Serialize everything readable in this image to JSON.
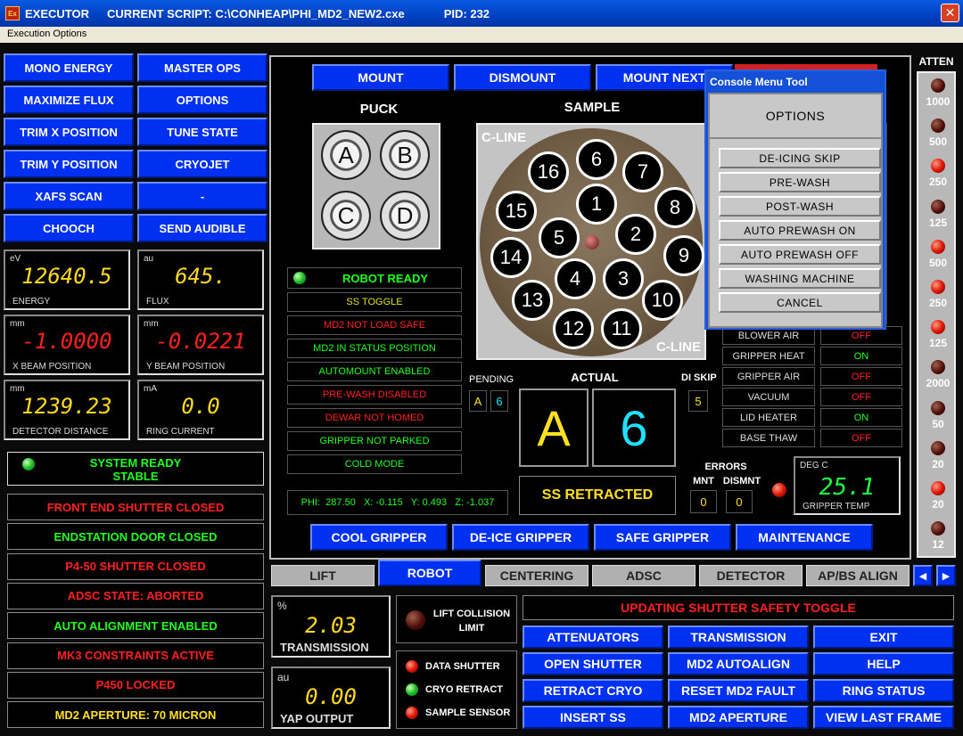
{
  "window": {
    "app": "EXECUTOR",
    "script": "CURRENT SCRIPT: C:\\CONHEAP\\PHI_MD2_NEW2.cxe",
    "pid": "PID: 232",
    "icon": "Ex",
    "close": "✕"
  },
  "menu": {
    "execution_options": "Execution Options"
  },
  "left_buttons": [
    [
      "MONO ENERGY",
      "MASTER OPS"
    ],
    [
      "MAXIMIZE FLUX",
      "OPTIONS"
    ],
    [
      "TRIM X POSITION",
      "TUNE STATE"
    ],
    [
      "TRIM Y POSITION",
      "CRYOJET"
    ],
    [
      "XAFS SCAN",
      "-"
    ],
    [
      "CHOOCH",
      "SEND AUDIBLE"
    ]
  ],
  "readouts": [
    {
      "unit": "eV",
      "value": "12640.5",
      "name": "ENERGY",
      "color": "#ffd820"
    },
    {
      "unit": "au",
      "value": "645.",
      "name": "FLUX",
      "color": "#ffd820"
    },
    {
      "unit": "mm",
      "value": "-1.0000",
      "name": "X BEAM POSITION",
      "color": "#ff2020"
    },
    {
      "unit": "mm",
      "value": "-0.0221",
      "name": "Y BEAM POSITION",
      "color": "#ff2020"
    },
    {
      "unit": "mm",
      "value": "1239.23",
      "name": "DETECTOR DISTANCE",
      "color": "#ffd820"
    },
    {
      "unit": "mA",
      "value": "0.0",
      "name": "RING CURRENT",
      "color": "#ffd820"
    }
  ],
  "system_ready": {
    "line1": "SYSTEM READY",
    "line2": "STABLE"
  },
  "status_list": [
    {
      "text": "FRONT END SHUTTER CLOSED",
      "color": "#ff2020"
    },
    {
      "text": "ENDSTATION DOOR CLOSED",
      "color": "#20ff20"
    },
    {
      "text": "P4-50 SHUTTER CLOSED",
      "color": "#ff2020"
    },
    {
      "text": "ADSC STATE: ABORTED",
      "color": "#ff2020"
    },
    {
      "text": "AUTO ALIGNMENT ENABLED",
      "color": "#20ff20"
    },
    {
      "text": "MK3 CONSTRAINTS ACTIVE",
      "color": "#ff2020"
    },
    {
      "text": "P450 LOCKED",
      "color": "#ff2020"
    },
    {
      "text": "MD2 APERTURE: 70 MICRON",
      "color": "#ffe020"
    }
  ],
  "robot": {
    "top_buttons": [
      "MOUNT",
      "DISMOUNT",
      "MOUNT NEXT"
    ],
    "puck_title": "PUCK",
    "sample_title": "SAMPLE",
    "pucks": [
      "A",
      "B",
      "C",
      "D"
    ],
    "cline_top": "C-LINE",
    "cline_bottom": "C-LINE",
    "slots": [
      "1",
      "2",
      "3",
      "4",
      "5",
      "6",
      "7",
      "8",
      "9",
      "10",
      "11",
      "12",
      "13",
      "14",
      "15",
      "16"
    ],
    "robot_ready": "ROBOT READY",
    "status": [
      {
        "text": "SS TOGGLE",
        "color": "#e0e020"
      },
      {
        "text": "MD2 NOT LOAD SAFE",
        "color": "#ff2020"
      },
      {
        "text": "MD2 IN STATUS POSITION",
        "color": "#20ff20"
      },
      {
        "text": "AUTOMOUNT ENABLED",
        "color": "#20ff20"
      },
      {
        "text": "PRE-WASH DISABLED",
        "color": "#ff2020"
      },
      {
        "text": "DEWAR NOT HOMED",
        "color": "#ff2020"
      },
      {
        "text": "GRIPPER NOT PARKED",
        "color": "#20ff20"
      },
      {
        "text": "COLD MODE",
        "color": "#20ff20"
      }
    ],
    "pending_label": "PENDING",
    "pending_puck": "A",
    "pending_sample": "6",
    "actual_label": "ACTUAL",
    "actual_puck": "A",
    "actual_sample": "6",
    "diskip_label": "DI SKIP",
    "diskip_value": "5",
    "coords": "PHI:  287.50   X: -0.115   Y: 0.493   Z: -1.037",
    "ss_retracted": "SS RETRACTED",
    "errors_label": "ERRORS",
    "mnt_label": "MNT",
    "dismnt_label": "DISMNT",
    "mnt_value": "0",
    "dismnt_value": "0",
    "temp_unit": "DEG C",
    "temp_value": "25.1",
    "temp_name": "GRIPPER TEMP",
    "valves": [
      {
        "label": "BLOWER AIR",
        "state": "OFF",
        "color": "#ff2020"
      },
      {
        "label": "GRIPPER HEAT",
        "state": "ON",
        "color": "#20ff20"
      },
      {
        "label": "GRIPPER AIR",
        "state": "OFF",
        "color": "#ff2020"
      },
      {
        "label": "VACUUM",
        "state": "OFF",
        "color": "#ff2020"
      },
      {
        "label": "LID HEATER",
        "state": "ON",
        "color": "#20ff20"
      },
      {
        "label": "BASE THAW",
        "state": "OFF",
        "color": "#ff2020"
      }
    ],
    "bottom_buttons": [
      "COOL GRIPPER",
      "DE-ICE GRIPPER",
      "SAFE GRIPPER",
      "MAINTENANCE"
    ]
  },
  "tabs": [
    "LIFT",
    "ROBOT",
    "CENTERING",
    "ADSC",
    "DETECTOR",
    "AP/BS ALIGN"
  ],
  "tab_arrows": [
    "◀",
    "▶"
  ],
  "transmission": {
    "unit": "%",
    "value": "2.03",
    "name": "TRANSMISSION"
  },
  "yap": {
    "unit": "au",
    "value": "0.00",
    "name": "YAP OUTPUT"
  },
  "lift_collision": {
    "line1": "LIFT COLLISION",
    "line2": "LIMIT"
  },
  "sensors": [
    "DATA SHUTTER",
    "CRYO RETRACT",
    "SAMPLE SENSOR"
  ],
  "message": "UPDATING SHUTTER SAFETY TOGGLE",
  "action_buttons": [
    [
      "ATTENUATORS",
      "TRANSMISSION",
      "EXIT"
    ],
    [
      "OPEN SHUTTER",
      "MD2 AUTOALIGN",
      "HELP"
    ],
    [
      "RETRACT CRYO",
      "RESET MD2 FAULT",
      "RING STATUS"
    ],
    [
      "INSERT SS",
      "MD2 APERTURE",
      "VIEW LAST FRAME"
    ]
  ],
  "atten": {
    "title": "ATTEN",
    "items": [
      {
        "value": "1000",
        "led": "dark"
      },
      {
        "value": "500",
        "led": "dark"
      },
      {
        "value": "250",
        "led": "red"
      },
      {
        "value": "125",
        "led": "dark"
      },
      {
        "value": "500",
        "led": "red"
      },
      {
        "value": "250",
        "led": "red"
      },
      {
        "value": "125",
        "led": "red"
      },
      {
        "value": "2000",
        "led": "dark"
      },
      {
        "value": "50",
        "led": "dark"
      },
      {
        "value": "20",
        "led": "dark"
      },
      {
        "value": "20",
        "led": "red"
      },
      {
        "value": "12",
        "led": "dark"
      }
    ]
  },
  "console_menu": {
    "title": "Console Menu Tool",
    "options": "OPTIONS",
    "items": [
      "DE-ICING SKIP",
      "PRE-WASH",
      "POST-WASH",
      "AUTO PREWASH ON",
      "AUTO PREWASH OFF",
      "WASHING MACHINE",
      "CANCEL"
    ]
  }
}
